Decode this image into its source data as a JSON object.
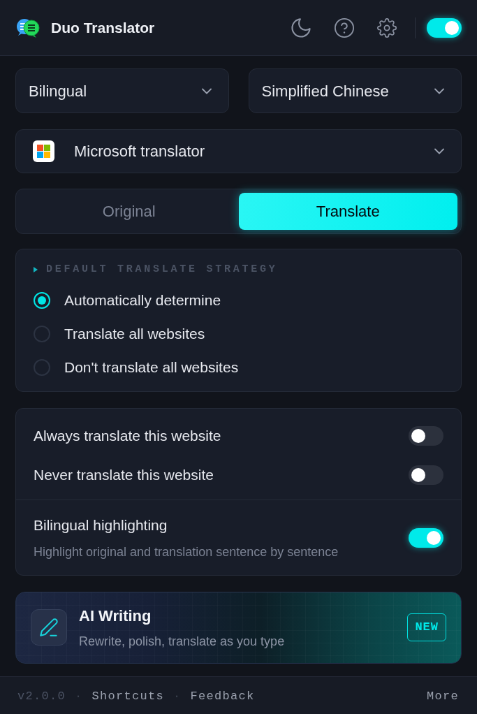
{
  "header": {
    "title": "Duo Translator",
    "enabled": true
  },
  "selects": [
    {
      "value": "Bilingual"
    },
    {
      "value": "Simplified Chinese"
    }
  ],
  "engine": {
    "value": "Microsoft translator"
  },
  "mode_tabs": [
    {
      "label": "Original",
      "selected": false
    },
    {
      "label": "Translate",
      "selected": true
    }
  ],
  "strategy": {
    "heading": "DEFAULT TRANSLATE STRATEGY",
    "options": [
      {
        "label": "Automatically determine",
        "selected": true
      },
      {
        "label": "Translate all websites",
        "selected": false
      },
      {
        "label": "Don't translate all websites",
        "selected": false
      }
    ]
  },
  "site_toggles": [
    {
      "label": "Always translate this website",
      "on": false
    },
    {
      "label": "Never translate this website",
      "on": false
    }
  ],
  "highlight": {
    "label": "Bilingual highlighting",
    "description": "Highlight original and translation sentence by sentence",
    "on": true
  },
  "ai_writing": {
    "title": "AI Writing",
    "subtitle": "Rewrite, polish, translate as you type",
    "badge": "NEW"
  },
  "footer": {
    "version": "v2.0.0",
    "separators": [
      "·",
      "·"
    ],
    "links": [
      "Shortcuts",
      "Feedback"
    ],
    "more": "More"
  }
}
